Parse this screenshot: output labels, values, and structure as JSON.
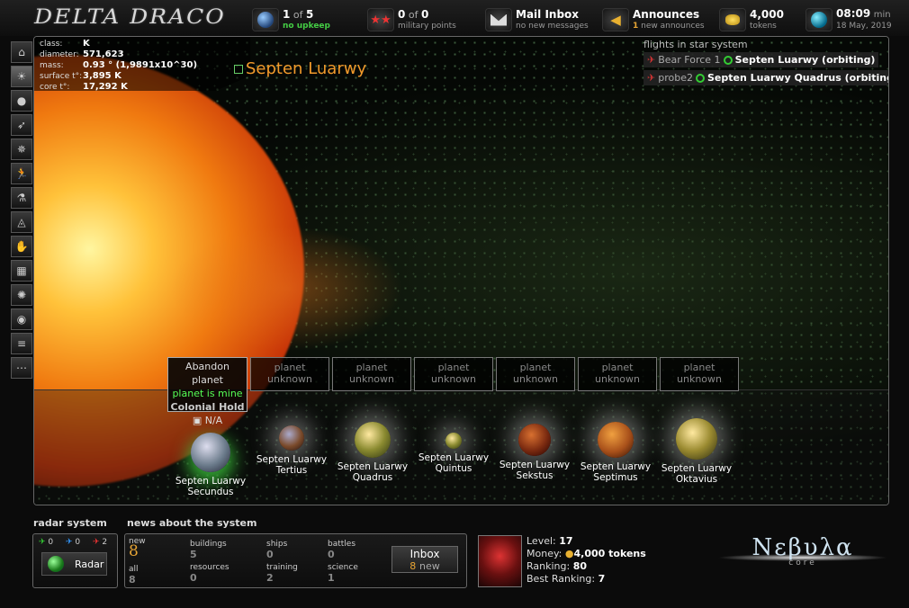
{
  "app": {
    "logo": "DELTA DRACO"
  },
  "topbar": {
    "planets": {
      "value": "1",
      "of": "of",
      "total": "5",
      "sub": "no upkeep"
    },
    "military": {
      "value": "0",
      "of": "of",
      "total": "0",
      "sub": "military points"
    },
    "mail": {
      "title": "Mail Inbox",
      "sub": "no new messages"
    },
    "announces": {
      "title": "Announces",
      "count": "1",
      "sub": "new announces"
    },
    "tokens": {
      "value": "4,000",
      "sub": "tokens"
    },
    "clock": {
      "time": "08:09",
      "unit": "min",
      "date": "18 May, 2019"
    }
  },
  "sidebar": {
    "icons": [
      "home-icon",
      "sun-icon",
      "planet-icon",
      "fleet-icon",
      "battle-icon",
      "runner-icon",
      "science-icon",
      "alliance-icon",
      "handshake-icon",
      "city-icon",
      "explosion-icon",
      "eye-icon",
      "ruins-icon",
      "more-icon"
    ]
  },
  "star": {
    "labels": {
      "class": "class:",
      "diameter": "diameter:",
      "mass": "mass:",
      "surface": "surface t°:",
      "core": "core t°:"
    },
    "values": {
      "class": "K",
      "diameter": "571,623",
      "mass": "0.93 ° (1,9891x10^30)",
      "surface": "3,895 K",
      "core": "17,292 K"
    },
    "system_name": "Septen Luarwy"
  },
  "flights": {
    "header": "flights in star system",
    "items": [
      {
        "ship": "Bear Force 1",
        "dest": "Septen Luarwy (orbiting)"
      },
      {
        "ship": "probe2",
        "dest": "Septen Luarwy Quadrus (orbiting)"
      }
    ]
  },
  "owned_slot": {
    "action": "Abandon planet",
    "status": "planet is mine",
    "type": "Colonial Hold",
    "value": "N/A"
  },
  "unknown_slot_label": "planet unknown",
  "planets": [
    {
      "name1": "Septen Luarwy",
      "name2": "Secundus"
    },
    {
      "name1": "Septen Luarwy",
      "name2": "Tertius"
    },
    {
      "name1": "Septen Luarwy",
      "name2": "Quadrus"
    },
    {
      "name1": "Septen Luarwy",
      "name2": "Quintus"
    },
    {
      "name1": "Septen Luarwy",
      "name2": "Sekstus"
    },
    {
      "name1": "Septen Luarwy",
      "name2": "Septimus"
    },
    {
      "name1": "Septen Luarwy",
      "name2": "Oktavius"
    }
  ],
  "radar": {
    "header": "radar system",
    "counts": [
      "0",
      "0",
      "2"
    ],
    "button": "Radar"
  },
  "news": {
    "header": "news about the system",
    "new_label": "new",
    "new_value": "8",
    "all_label": "all",
    "all_value": "8",
    "buildings_label": "buildings",
    "buildings_value": "5",
    "resources_label": "resources",
    "resources_value": "0",
    "ships_label": "ships",
    "ships_value": "0",
    "training_label": "training",
    "training_value": "2",
    "battles_label": "battles",
    "battles_value": "0",
    "science_label": "science",
    "science_value": "1",
    "inbox_label": "Inbox",
    "inbox_count": "8",
    "inbox_new": "new"
  },
  "player": {
    "level_label": "Level:",
    "level": "17",
    "money_label": "Money:",
    "money": "4,000 tokens",
    "ranking_label": "Ranking:",
    "ranking": "80",
    "best_label": "Best Ranking:",
    "best": "7"
  },
  "brand": {
    "name": "Νεβυλα",
    "sub": "core"
  }
}
